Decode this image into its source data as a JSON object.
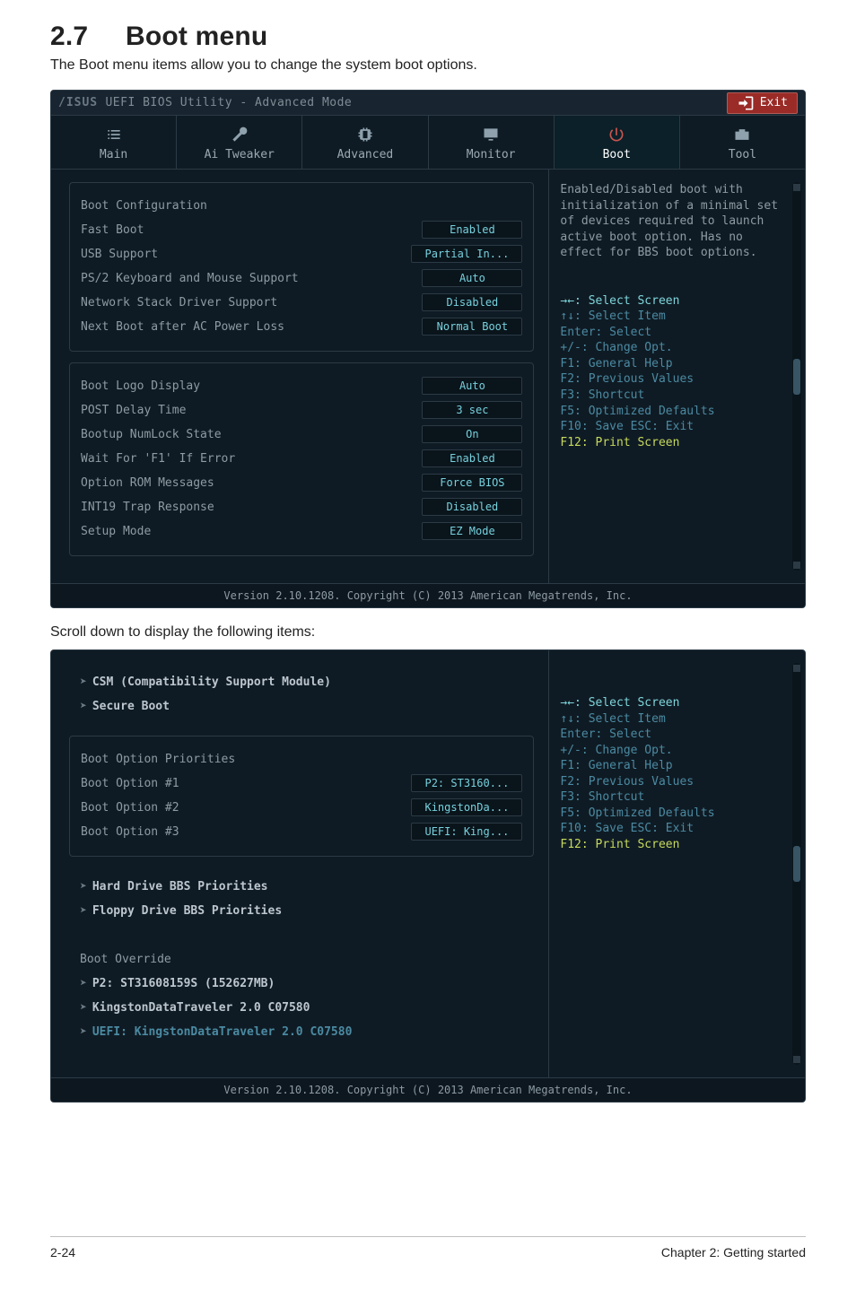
{
  "page": {
    "section_no": "2.7",
    "section_title": "Boot menu",
    "lead": "The Boot menu items allow you to change the system boot options.",
    "subhead": "Scroll down to display the following items:",
    "footer_left": "2-24",
    "footer_right": "Chapter 2: Getting started"
  },
  "bios1": {
    "brand_left": "/ISUS",
    "brand_rest": "UEFI BIOS Utility - Advanced Mode",
    "exit_label": "Exit",
    "tabs": [
      {
        "name": "main",
        "label": "Main"
      },
      {
        "name": "aitweaker",
        "label": "Ai Tweaker"
      },
      {
        "name": "advanced",
        "label": "Advanced"
      },
      {
        "name": "monitor",
        "label": "Monitor"
      },
      {
        "name": "boot",
        "label": "Boot",
        "active": true
      },
      {
        "name": "tool",
        "label": "Tool"
      }
    ],
    "group1_title": "Boot Configuration",
    "rows1": [
      {
        "label": "Fast Boot",
        "value": "Enabled"
      },
      {
        "label": "USB Support",
        "value": "Partial In..."
      },
      {
        "label": "PS/2 Keyboard and Mouse Support",
        "value": "Auto"
      },
      {
        "label": "Network Stack Driver Support",
        "value": "Disabled"
      },
      {
        "label": "Next Boot after AC Power Loss",
        "value": "Normal Boot"
      }
    ],
    "rows2": [
      {
        "label": "Boot Logo Display",
        "value": "Auto"
      },
      {
        "label": "POST Delay Time",
        "value": "3 sec"
      },
      {
        "label": "Bootup NumLock State",
        "value": "On"
      },
      {
        "label": "Wait For 'F1' If Error",
        "value": "Enabled"
      },
      {
        "label": "Option ROM Messages",
        "value": "Force BIOS"
      },
      {
        "label": "INT19 Trap Response",
        "value": "Disabled"
      },
      {
        "label": "Setup Mode",
        "value": "EZ Mode"
      }
    ],
    "desc": "Enabled/Disabled boot with initialization of a minimal set of devices required to launch active boot option. Has no effect for BBS boot options.",
    "keys_title": "→←: Select Screen",
    "keys": [
      "↑↓: Select Item",
      "Enter: Select",
      "+/-: Change Opt.",
      "F1: General Help",
      "F2: Previous Values",
      "F3: Shortcut",
      "F5: Optimized Defaults",
      "F10: Save  ESC: Exit",
      "F12: Print Screen"
    ],
    "footer": "Version 2.10.1208. Copyright (C) 2013 American Megatrends, Inc."
  },
  "bios2": {
    "rows_top": [
      {
        "label": "CSM (Compatibility Support Module)",
        "type": "menu"
      },
      {
        "label": "Secure Boot",
        "type": "menu"
      }
    ],
    "group_title": "Boot Option Priorities",
    "rows_opts": [
      {
        "label": "Boot Option #1",
        "value": "P2: ST3160..."
      },
      {
        "label": "Boot Option #2",
        "value": "KingstonDa..."
      },
      {
        "label": "Boot Option #3",
        "value": "UEFI: King..."
      }
    ],
    "rows_bottom": [
      {
        "label": "Hard Drive BBS Priorities",
        "type": "menu"
      },
      {
        "label": "Floppy Drive BBS Priorities",
        "type": "menu"
      }
    ],
    "override_title": "Boot Override",
    "override": [
      {
        "label": "P2: ST31608159S  (152627MB)"
      },
      {
        "label": "KingstonDataTraveler 2.0  C07580"
      },
      {
        "label": "UEFI: KingstonDataTraveler 2.0 C07580",
        "blue": true
      }
    ],
    "desc": "",
    "keys_title": "→←: Select Screen",
    "keys": [
      "↑↓: Select Item",
      "Enter: Select",
      "+/-: Change Opt.",
      "F1: General Help",
      "F2: Previous Values",
      "F3: Shortcut",
      "F5: Optimized Defaults",
      "F10: Save  ESC: Exit",
      "F12: Print Screen"
    ],
    "footer": "Version 2.10.1208. Copyright (C) 2013 American Megatrends, Inc."
  }
}
